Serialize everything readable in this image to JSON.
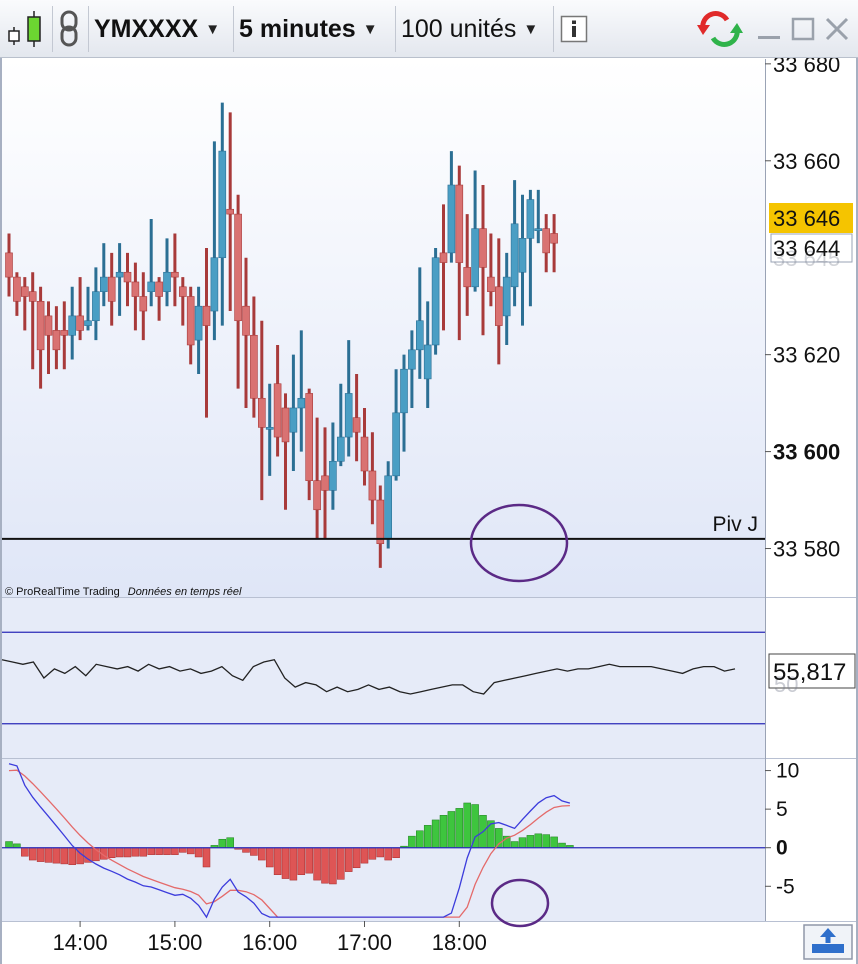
{
  "toolbar": {
    "symbol": "YMXXXX",
    "timeframe": "5 minutes",
    "units": "100 unités"
  },
  "price_panel": {
    "credit": "© ProRealTime Trading",
    "realtime": "Données en temps réel",
    "pivot_label": "Piv J",
    "last_price": "33 646",
    "bid_price": "33 644",
    "bid_price_hidden": "33 645"
  },
  "rsi_panel": {
    "value_label": "55,817",
    "value_hidden": "50"
  },
  "colors": {
    "up": "#4a9ec4",
    "down": "#d97272",
    "down_wick": "#a83a3a",
    "up_wick": "#2b6f94",
    "hist_pos": "#3ec53e",
    "hist_neg": "#de5555",
    "macd_line": "#3c3cdc",
    "signal_line": "#e46a6a",
    "rsi_line": "#222222",
    "annotation": "#5b2a86",
    "last_price_bg": "#f5c400"
  },
  "chart_data": [
    {
      "type": "candlestick",
      "title": "YMXXXX",
      "x_labels": [
        "14:00",
        "15:00",
        "16:00",
        "17:00",
        "18:00"
      ],
      "y_ticks": [
        "33 680",
        "33 660",
        "33 620",
        "33 600",
        "33 580"
      ],
      "ylim": [
        33570,
        33681
      ],
      "pivot_level": 33582,
      "bar_interval_min": 5,
      "candles": [
        [
          33641,
          33645,
          33632,
          33636
        ],
        [
          33636,
          33637,
          33628,
          33631
        ],
        [
          33634,
          33636,
          33625,
          33632
        ],
        [
          33633,
          33637,
          33617,
          33631
        ],
        [
          33631,
          33634,
          33613,
          33621
        ],
        [
          33628,
          33631,
          33616,
          33624
        ],
        [
          33625,
          33630,
          33617,
          33621
        ],
        [
          33625,
          33631,
          33617,
          33624
        ],
        [
          33624,
          33634,
          33619,
          33628
        ],
        [
          33628,
          33636,
          33623,
          33625
        ],
        [
          33626,
          33634,
          33625,
          33627
        ],
        [
          33627,
          33638,
          33623,
          33633
        ],
        [
          33633,
          33643,
          33630,
          33636
        ],
        [
          33636,
          33641,
          33626,
          33631
        ],
        [
          33636,
          33643,
          33628,
          33637
        ],
        [
          33637,
          33641,
          33630,
          33635
        ],
        [
          33635,
          33639,
          33625,
          33632
        ],
        [
          33632,
          33637,
          33623,
          33629
        ],
        [
          33633,
          33648,
          33630,
          33635
        ],
        [
          33635,
          33636,
          33627,
          33632
        ],
        [
          33633,
          33644,
          33630,
          33637
        ],
        [
          33637,
          33645,
          33630,
          33636
        ],
        [
          33634,
          33636,
          33626,
          33632
        ],
        [
          33632,
          33634,
          33618,
          33622
        ],
        [
          33623,
          33634,
          33616,
          33630
        ],
        [
          33630,
          33642,
          33607,
          33626
        ],
        [
          33629,
          33664,
          33623,
          33640
        ],
        [
          33640,
          33672,
          33626,
          33662
        ],
        [
          33650,
          33670,
          33629,
          33649
        ],
        [
          33649,
          33653,
          33613,
          33627
        ],
        [
          33630,
          33640,
          33609,
          33624
        ],
        [
          33624,
          33632,
          33607,
          33611
        ],
        [
          33611,
          33627,
          33590,
          33605
        ],
        [
          33605,
          33614,
          33595,
          33605
        ],
        [
          33614,
          33622,
          33599,
          33603
        ],
        [
          33609,
          33612,
          33588,
          33602
        ],
        [
          33604,
          33620,
          33596,
          33609
        ],
        [
          33609,
          33625,
          33600,
          33611
        ],
        [
          33612,
          33613,
          33590,
          33594
        ],
        [
          33594,
          33607,
          33582,
          33588
        ],
        [
          33595,
          33605,
          33582,
          33592
        ],
        [
          33592,
          33606,
          33588,
          33598
        ],
        [
          33598,
          33614,
          33597,
          33603
        ],
        [
          33603,
          33623,
          33599,
          33612
        ],
        [
          33607,
          33616,
          33598,
          33604
        ],
        [
          33603,
          33609,
          33593,
          33596
        ],
        [
          33596,
          33604,
          33585,
          33590
        ],
        [
          33590,
          33593,
          33576,
          33581
        ],
        [
          33582,
          33598,
          33580,
          33595
        ],
        [
          33595,
          33617,
          33594,
          33608
        ],
        [
          33608,
          33620,
          33600,
          33617
        ],
        [
          33617,
          33625,
          33609,
          33621
        ],
        [
          33621,
          33638,
          33615,
          33627
        ],
        [
          33615,
          33631,
          33609,
          33622
        ],
        [
          33622,
          33642,
          33620,
          33640
        ],
        [
          33641,
          33651,
          33625,
          33639
        ],
        [
          33641,
          33662,
          33639,
          33655
        ],
        [
          33655,
          33659,
          33623,
          33639
        ],
        [
          33638,
          33649,
          33628,
          33634
        ],
        [
          33634,
          33658,
          33633,
          33646
        ],
        [
          33646,
          33655,
          33624,
          33638
        ],
        [
          33636,
          33645,
          33630,
          33633
        ],
        [
          33634,
          33644,
          33618,
          33626
        ],
        [
          33628,
          33641,
          33622,
          33636
        ],
        [
          33634,
          33656,
          33630,
          33647
        ],
        [
          33637,
          33653,
          33626,
          33644
        ],
        [
          33644,
          33654,
          33630,
          33652
        ],
        [
          33646,
          33654,
          33643,
          33646
        ],
        [
          33646,
          33649,
          33637,
          33641
        ],
        [
          33645,
          33649,
          33637,
          33643
        ]
      ]
    },
    {
      "type": "line",
      "title": "RSI",
      "current_value": 55.817,
      "ylim": [
        15,
        85
      ],
      "bands": [
        70,
        30
      ],
      "values": [
        58,
        57,
        56,
        57,
        50,
        54,
        52,
        55,
        51,
        56,
        55,
        54,
        55,
        53,
        56,
        54,
        55,
        53,
        54,
        52,
        53,
        55,
        51,
        49,
        55,
        57,
        58,
        50,
        46,
        48,
        47,
        44,
        46,
        44,
        45,
        47,
        45,
        46,
        44,
        43,
        44,
        45,
        46,
        47,
        47,
        44,
        43,
        48,
        49,
        50,
        51,
        52,
        53,
        54,
        53,
        54,
        54,
        55,
        56,
        55,
        55,
        55,
        55,
        54,
        53,
        52,
        54,
        55,
        55,
        53,
        54
      ]
    },
    {
      "type": "bar",
      "title": "MACD",
      "y_ticks": [
        "10",
        "5",
        "0",
        "-5"
      ],
      "ylim": [
        -9.5,
        11.5
      ],
      "histogram": [
        0.8,
        0.5,
        -1.1,
        -1.6,
        -1.8,
        -1.9,
        -2.0,
        -2.1,
        -2.2,
        -2.1,
        -1.9,
        -1.7,
        -1.5,
        -1.3,
        -1.2,
        -1.2,
        -1.1,
        -1.1,
        -0.9,
        -0.9,
        -0.9,
        -0.9,
        -0.6,
        -0.8,
        -1.2,
        -2.5,
        0.3,
        1.1,
        1.3,
        -0.2,
        -0.6,
        -1.0,
        -1.6,
        -2.5,
        -3.5,
        -4.0,
        -4.2,
        -3.5,
        -3.3,
        -4.2,
        -4.6,
        -4.7,
        -4.1,
        -3.1,
        -2.6,
        -2.0,
        -1.5,
        -1.2,
        -1.6,
        -1.3,
        0.2,
        1.5,
        2.2,
        2.9,
        3.6,
        4.2,
        4.7,
        5.1,
        5.8,
        5.6,
        4.2,
        3.5,
        2.5,
        1.5,
        0.8,
        1.3,
        1.6,
        1.8,
        1.7,
        1.4,
        0.6,
        0.3
      ]
    }
  ]
}
